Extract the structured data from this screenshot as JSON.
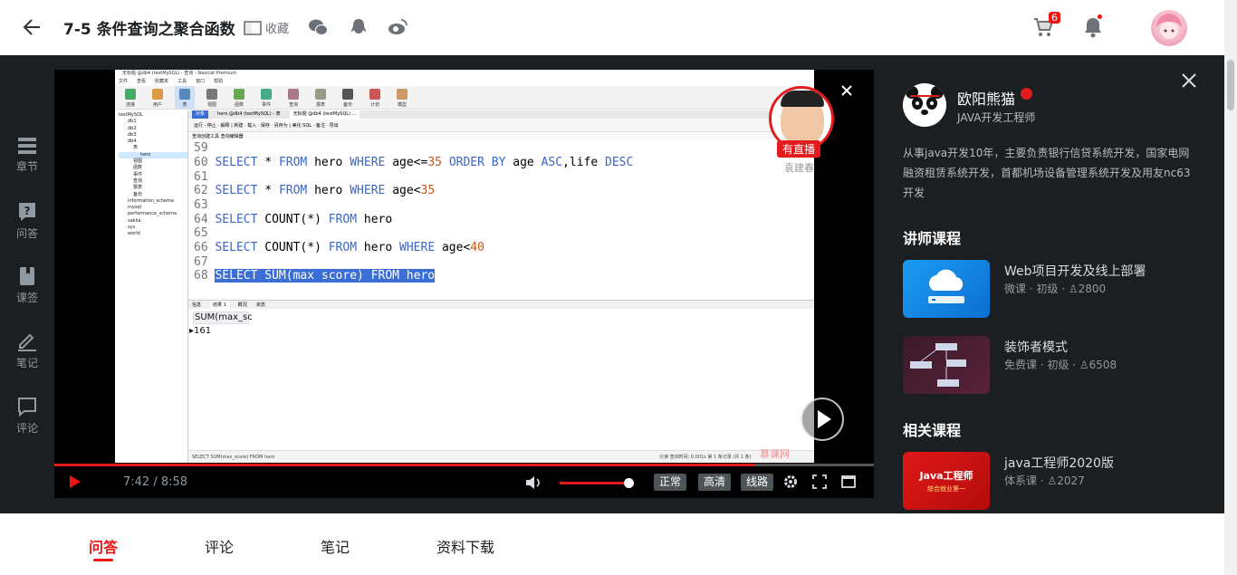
{
  "header": {
    "title": "7-5 条件查询之聚合函数",
    "fav_label": "收藏",
    "cart_count": "6"
  },
  "leftnav": {
    "items": [
      {
        "label": "章节",
        "icon": "chapter-icon"
      },
      {
        "label": "问答",
        "icon": "question-icon"
      },
      {
        "label": "课签",
        "icon": "bookmark-icon"
      },
      {
        "label": "笔记",
        "icon": "edit-icon"
      },
      {
        "label": "评论",
        "icon": "comment-icon"
      }
    ]
  },
  "video": {
    "navicat_title": "无标题 @db4 (testMySQL) - 查询 - Navicat Premium",
    "menu": [
      "文件",
      "查看",
      "收藏夹",
      "工具",
      "窗口",
      "帮助"
    ],
    "toolbar": [
      "连接",
      "用户",
      "表",
      "视图",
      "函数",
      "事件",
      "查询",
      "报表",
      "备份",
      "计划",
      "模型"
    ],
    "tree": [
      "testMySQL",
      "db1",
      "db2",
      "db3",
      "db4",
      "表",
      "hero",
      "视图",
      "函数",
      "事件",
      "查询",
      "报表",
      "备份",
      "information_schema",
      "mysql",
      "performance_schema",
      "sakila",
      "sys",
      "world"
    ],
    "tabs": [
      "对象",
      "hero @db4 (testMySQL) - 表",
      "无标题 @db4 (testMySQL) ..."
    ],
    "subtoolbar": "运行 · 停止 · 解释 | 新建 · 载入 · 保存 · 另存为 | 美化 SQL · 备注 · 导出",
    "subbar2": "查询创建工具   查询编辑器",
    "code_lines": [
      {
        "n": "59",
        "text": ""
      },
      {
        "n": "60",
        "text": "SELECT * FROM hero WHERE age<=35 ORDER BY age ASC,life DESC"
      },
      {
        "n": "61",
        "text": ""
      },
      {
        "n": "62",
        "text": "SELECT * FROM hero WHERE age<35"
      },
      {
        "n": "63",
        "text": ""
      },
      {
        "n": "64",
        "text": "SELECT COUNT(*) FROM hero"
      },
      {
        "n": "65",
        "text": ""
      },
      {
        "n": "66",
        "text": "SELECT COUNT(*) FROM hero WHERE age<40"
      },
      {
        "n": "67",
        "text": ""
      },
      {
        "n": "68",
        "text": "SELECT SUM(max score) FROM hero"
      }
    ],
    "result_tabs": [
      "信息",
      "结果 1",
      "概况",
      "状态"
    ],
    "result_header": "SUM(max_sc",
    "result_value": "161",
    "status_text": "SELECT SUM(max_score) FROM hero",
    "status_right": "只读      查询时间: 0.001s      第 1 条记录 (共 1 条)",
    "watermark": "慕课网",
    "live_badge": "有直播",
    "live_name": "袁建春",
    "time": "7:42 / 8:58",
    "progress": 0.855,
    "volume": 0.95,
    "quality_buttons": [
      "正常",
      "高清",
      "线路"
    ]
  },
  "teacher": {
    "name": "欧阳熊猫",
    "role": "JAVA开发工程师",
    "desc": "从事java开发10年，主要负责银行信贷系统开发，国家电网融资租赁系统开发，首都机场设备管理系统开发及用友nc63开发"
  },
  "sections": {
    "teacher_courses": "讲师课程",
    "related_courses": "相关课程"
  },
  "courses": [
    {
      "title": "Web项目开发及线上部署",
      "meta": "微课 · 初级 · ♙2800",
      "thumb": "cloud"
    },
    {
      "title": "装饰者模式",
      "meta": "免费课 · 初级 · ♙6508",
      "thumb": "diagram"
    },
    {
      "title": "java工程师2020版",
      "meta": "体系课 · ♙2027",
      "thumb": "java",
      "thumb_text": "Java工程师",
      "thumb_sub": "综合就业第一"
    }
  ],
  "bottom_tabs": [
    "问答",
    "评论",
    "笔记",
    "资料下载"
  ],
  "colors": {
    "accent": "#f01414",
    "dark_bg": "#1c1f21"
  }
}
